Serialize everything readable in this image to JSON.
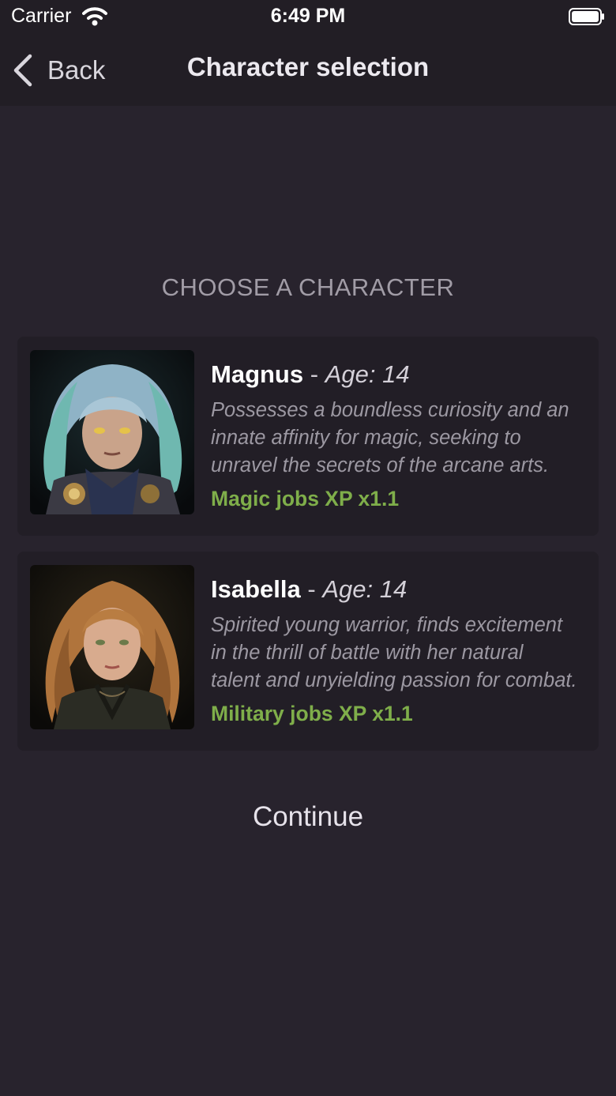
{
  "status_bar": {
    "carrier": "Carrier",
    "time": "6:49 PM",
    "icons": [
      "wifi-icon",
      "battery-icon"
    ]
  },
  "nav": {
    "back_label": "Back",
    "title": "Character selection",
    "back_icon": "chevron-left-icon"
  },
  "heading": "CHOOSE A CHARACTER",
  "characters": [
    {
      "name": "Magnus",
      "separator": "-",
      "age_label": "Age:",
      "age": "14",
      "description_lines": [
        "Possesses a boundless curiosity and an",
        "innate affinity for magic, seeking to",
        "unravel the secrets of the arcane arts."
      ],
      "bonus": "Magic jobs XP x1.1"
    },
    {
      "name": "Isabella",
      "separator": "-",
      "age_label": "Age:",
      "age": "14",
      "description_lines": [
        "Spirited young warrior, finds excitement",
        "in the thrill of battle with her natural",
        "talent and unyielding passion for combat."
      ],
      "bonus": "Military jobs XP x1.1"
    }
  ],
  "continue_label": "Continue",
  "colors": {
    "background": "#28232d",
    "bar": "#221e25",
    "card": "#221e26",
    "bonus_green": "#7fae4a",
    "muted_text": "#9c98a2"
  }
}
